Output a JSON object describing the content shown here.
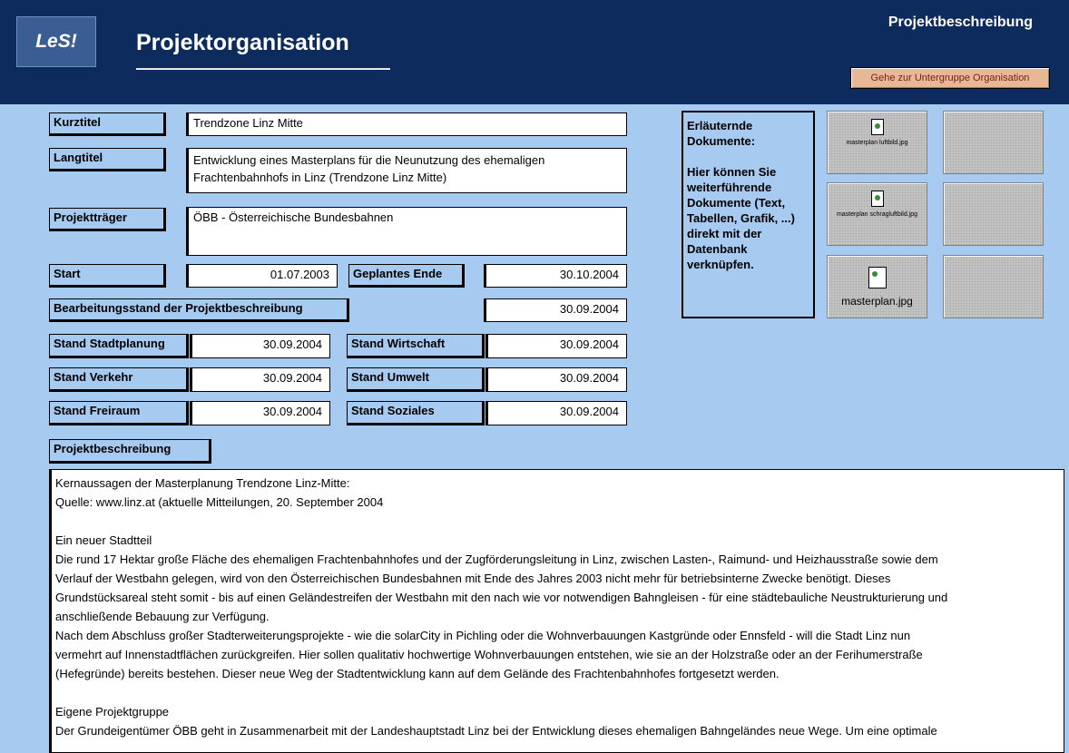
{
  "header": {
    "logo": "LeS!",
    "title": "Projektorganisation",
    "section": "Projektbeschreibung",
    "goto_button": "Gehe zur Untergruppe Organisation"
  },
  "fields": {
    "kurztitel_label": "Kurztitel",
    "kurztitel_value": "Trendzone Linz Mitte",
    "langtitel_label": "Langtitel",
    "langtitel_value_1": "Entwicklung eines Masterplans für die Neunutzung des ehemaligen",
    "langtitel_value_2": "Frachtenbahnhofs in Linz (Trendzone Linz Mitte)",
    "projekttraeger_label": "Projektträger",
    "projekttraeger_value": "ÖBB - Österreichische Bundesbahnen",
    "start_label": "Start",
    "start_value": "01.07.2003",
    "geplantes_ende_label": "Geplantes Ende",
    "geplantes_ende_value": "30.10.2004",
    "bearbeitungsstand_label": "Bearbeitungsstand der Projektbeschreibung",
    "bearbeitungsstand_value": "30.09.2004",
    "stand_stadtplanung_label": "Stand Stadtplanung",
    "stand_stadtplanung_value": "30.09.2004",
    "stand_wirtschaft_label": "Stand Wirtschaft",
    "stand_wirtschaft_value": "30.09.2004",
    "stand_verkehr_label": "Stand Verkehr",
    "stand_verkehr_value": "30.09.2004",
    "stand_umwelt_label": "Stand Umwelt",
    "stand_umwelt_value": "30.09.2004",
    "stand_freiraum_label": "Stand Freiraum",
    "stand_freiraum_value": "30.09.2004",
    "stand_soziales_label": "Stand Soziales",
    "stand_soziales_value": "30.09.2004"
  },
  "info": {
    "heading_1": "Erläuternde",
    "heading_2": "Dokumente:",
    "body_1": "Hier können Sie",
    "body_2": "weiterführende",
    "body_3": "Dokumente (Text,",
    "body_4": "Tabellen, Grafik, ...)",
    "body_5": "direkt mit der",
    "body_6": "Datenbank",
    "body_7": "verknüpfen."
  },
  "documents": [
    {
      "name": "masterplan luftbild.jpg",
      "icon": "image-file-icon"
    },
    {
      "name": "masterplan schragluftbild.jpg",
      "icon": "image-file-icon"
    },
    {
      "name": "masterplan.jpg",
      "icon": "image-file-icon"
    }
  ],
  "description": {
    "label": "Projektbeschreibung",
    "lines": [
      "Kernaussagen der Masterplanung Trendzone Linz-Mitte:",
      "Quelle: www.linz.at (aktuelle Mitteilungen, 20. September 2004",
      "",
      "Ein neuer Stadtteil",
      "Die rund 17 Hektar große Fläche des ehemaligen Frachtenbahnhofes und der Zugförderungsleitung in Linz, zwischen Lasten-, Raimund- und Heizhausstraße sowie dem",
      "Verlauf der Westbahn gelegen, wird von den Österreichischen Bundesbahnen mit Ende des Jahres 2003 nicht mehr für betriebsinterne Zwecke benötigt. Dieses",
      "Grundstücksareal steht somit - bis auf einen Geländestreifen der Westbahn mit den nach wie vor notwendigen Bahngleisen - für eine städtebauliche Neustrukturierung und",
      "anschließende Bebauung zur Verfügung.",
      "Nach dem Abschluss großer Stadterweiterungsprojekte - wie die solarCity in Pichling oder die Wohnverbauungen Kastgründe oder Ennsfeld - will die Stadt Linz nun",
      "vermehrt auf Innenstadtflächen zurückgreifen. Hier sollen qualitativ hochwertige Wohnverbauungen entstehen, wie sie an der Holzstraße oder an der Ferihumerstraße",
      "(Hefegründe) bereits bestehen. Dieser neue Weg der Stadtentwicklung kann auf dem Gelände des Frachtenbahnhofes fortgesetzt werden.",
      "",
      "Eigene Projektgruppe",
      "Der Grundeigentümer ÖBB geht in Zusammenarbeit mit der Landeshauptstadt Linz bei der Entwicklung dieses ehemaligen Bahngeländes neue Wege. Um eine optimale"
    ]
  }
}
